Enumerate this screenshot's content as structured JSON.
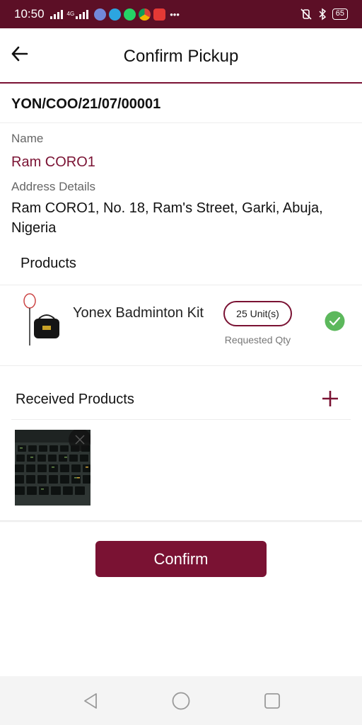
{
  "status_bar": {
    "time": "10:50",
    "network_label": "4G",
    "battery": "65",
    "colors": {
      "background": "#5c0f26"
    },
    "icons": [
      "signal-icon",
      "discord-icon",
      "telegram-icon",
      "whatsapp-icon",
      "chrome-icon",
      "app-icon",
      "more-dots-icon",
      "mute-icon",
      "bluetooth-icon",
      "battery-icon"
    ]
  },
  "header": {
    "title": "Confirm Pickup",
    "back_icon": "arrow-left-icon"
  },
  "order": {
    "id": "YON/COO/21/07/00001"
  },
  "customer": {
    "name_label": "Name",
    "name": "Ram CORO1",
    "address_label": "Address Details",
    "address": "Ram CORO1, No. 18, Ram's Street, Garki, Abuja, Nigeria"
  },
  "products": {
    "title": "Products",
    "items": [
      {
        "name": "Yonex Badminton Kit",
        "quantity": "25 Unit(s)",
        "quantity_caption": "Requested Qty",
        "status_icon": "check-circle-icon"
      }
    ]
  },
  "received_products": {
    "title": "Received Products",
    "add_icon": "plus-icon"
  },
  "actions": {
    "confirm_label": "Confirm"
  },
  "colors": {
    "accent": "#7a1233",
    "check": "#5cb85c"
  },
  "nav_bar": {
    "icons": [
      "back-triangle-icon",
      "home-circle-icon",
      "recents-square-icon"
    ]
  }
}
